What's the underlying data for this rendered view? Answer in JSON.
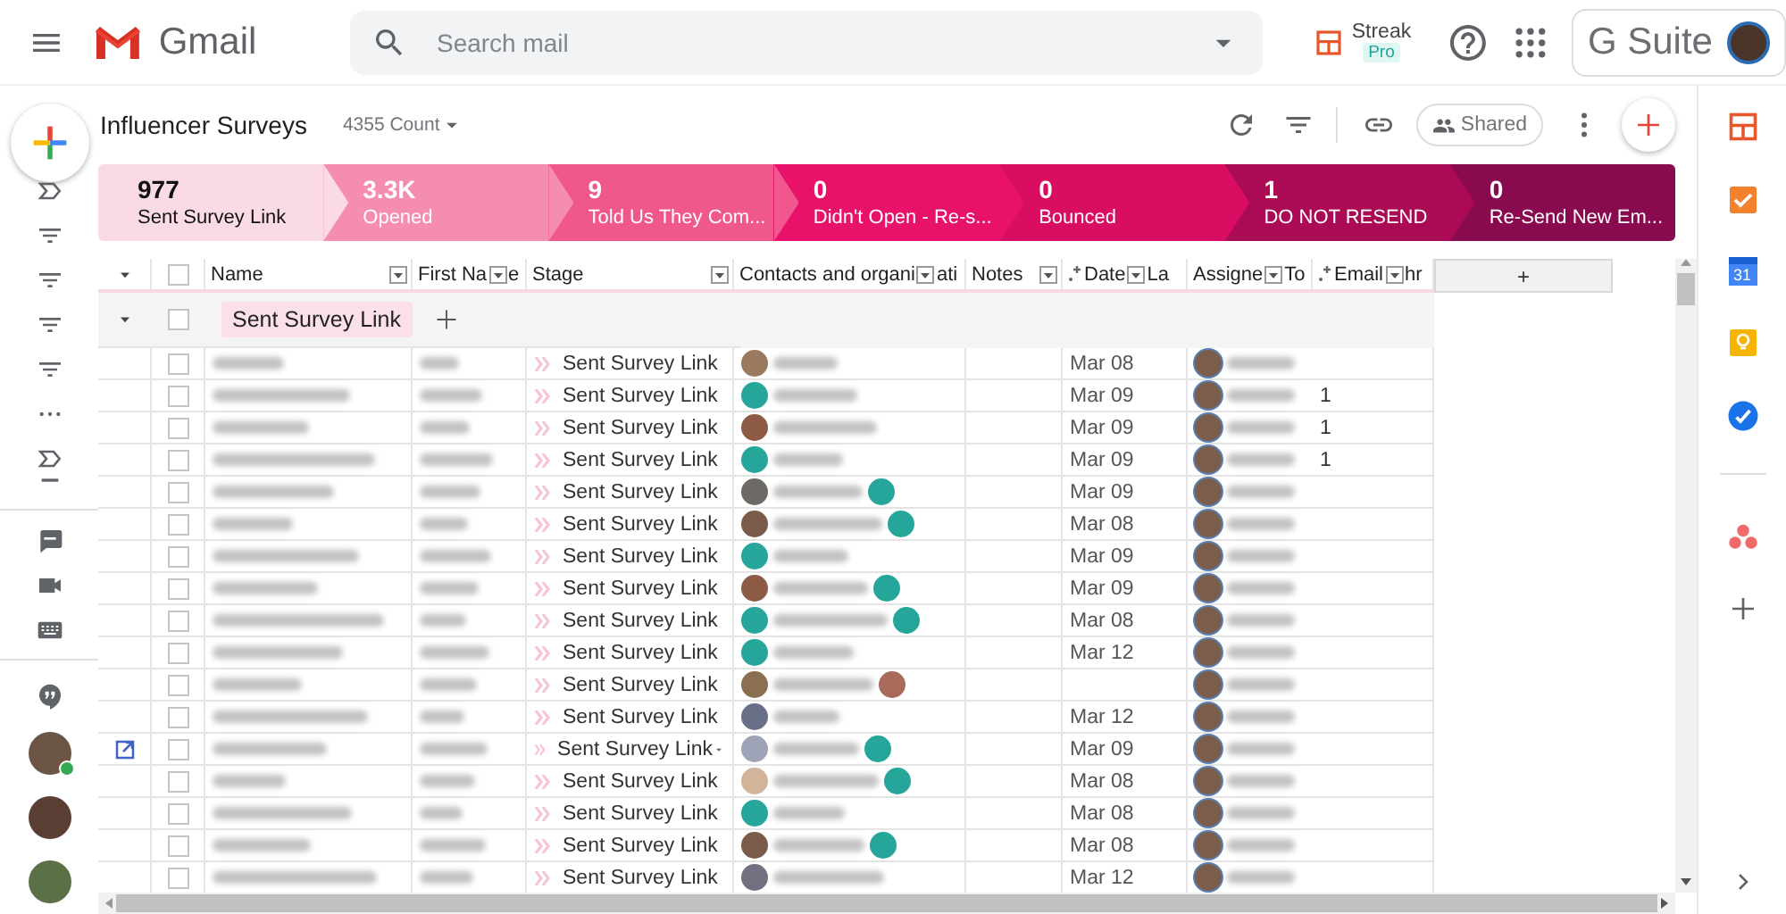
{
  "topbar": {
    "app_name": "Gmail",
    "search": {
      "placeholder": "Search mail"
    },
    "streak": {
      "label": "Streak",
      "badge": "Pro"
    },
    "suite": {
      "label": "G Suite"
    }
  },
  "rail": {
    "contacts": [
      {
        "online": true
      },
      {
        "online": false
      },
      {
        "online": false
      }
    ]
  },
  "pipeline": {
    "title": "Influencer Surveys",
    "count": "4355 Count",
    "share": {
      "label": "Shared"
    }
  },
  "stages": [
    {
      "count": "977",
      "label": "Sent Survey Link",
      "color": "#fadbe5"
    },
    {
      "count": "3.3K",
      "label": "Opened",
      "color": "#f58db0"
    },
    {
      "count": "9",
      "label": "Told Us They Com...",
      "color": "#f0588d"
    },
    {
      "count": "0",
      "label": "Didn't Open - Re-s...",
      "color": "#e8126a"
    },
    {
      "count": "0",
      "label": "Bounced",
      "color": "#d90d62"
    },
    {
      "count": "1",
      "label": "DO NOT RESEND",
      "color": "#ab0a54"
    },
    {
      "count": "0",
      "label": "Re-Send New Em...",
      "color": "#8a0a4f"
    }
  ],
  "table": {
    "columns": [
      {
        "label": "Name",
        "kind": "field"
      },
      {
        "label": "First Na",
        "tail": "e",
        "kind": "field"
      },
      {
        "label": "Stage",
        "kind": "field"
      },
      {
        "label": "Contacts and organi",
        "tail": "ati",
        "kind": "field"
      },
      {
        "label": "Notes",
        "kind": "field"
      },
      {
        "label": "Date",
        "tail": "La",
        "kind": "auto"
      },
      {
        "label": "Assigne",
        "tail": "To",
        "kind": "field"
      },
      {
        "label": "Email",
        "tail": "hr",
        "kind": "auto"
      }
    ],
    "all_checked": false,
    "add_column": "+",
    "group": {
      "label": "Sent Survey Link",
      "expanded": true,
      "checked": false
    },
    "rows": [
      {
        "stage": "Sent Survey Link",
        "date": "Mar 08",
        "checked": false,
        "hovered": false,
        "contacts": [
          {
            "color": "#9a7a5e"
          }
        ]
      },
      {
        "stage": "Sent Survey Link",
        "date": "Mar 09",
        "email": "1",
        "checked": false,
        "hovered": false,
        "contacts": [
          {
            "color": "#26a69a"
          }
        ]
      },
      {
        "stage": "Sent Survey Link",
        "date": "Mar 09",
        "email": "1",
        "checked": false,
        "hovered": false,
        "contacts": [
          {
            "color": "#8d5a44"
          }
        ]
      },
      {
        "stage": "Sent Survey Link",
        "date": "Mar 09",
        "email": "1",
        "checked": false,
        "hovered": false,
        "contacts": [
          {
            "color": "#26a69a"
          }
        ]
      },
      {
        "stage": "Sent Survey Link",
        "date": "Mar 09",
        "checked": false,
        "hovered": false,
        "contacts": [
          {
            "color": "#6d6a66"
          },
          {
            "color": "#26a69a"
          }
        ]
      },
      {
        "stage": "Sent Survey Link",
        "date": "Mar 08",
        "checked": false,
        "hovered": false,
        "contacts": [
          {
            "color": "#7a5a48"
          },
          {
            "color": "#26a69a"
          }
        ]
      },
      {
        "stage": "Sent Survey Link",
        "date": "Mar 09",
        "checked": false,
        "hovered": false,
        "contacts": [
          {
            "color": "#26a69a"
          }
        ]
      },
      {
        "stage": "Sent Survey Link",
        "date": "Mar 09",
        "checked": false,
        "hovered": false,
        "contacts": [
          {
            "color": "#8d5a44"
          },
          {
            "color": "#26a69a"
          }
        ]
      },
      {
        "stage": "Sent Survey Link",
        "date": "Mar 08",
        "checked": false,
        "hovered": false,
        "contacts": [
          {
            "color": "#26a69a"
          },
          {
            "color": "#26a69a"
          }
        ]
      },
      {
        "stage": "Sent Survey Link",
        "date": "Mar 12",
        "checked": false,
        "hovered": false,
        "contacts": [
          {
            "color": "#26a69a"
          }
        ]
      },
      {
        "stage": "Sent Survey Link",
        "checked": false,
        "hovered": false,
        "contacts": [
          {
            "color": "#8a7050"
          },
          {
            "color": "#a86a5a"
          }
        ]
      },
      {
        "stage": "Sent Survey Link",
        "date": "Mar 12",
        "checked": false,
        "hovered": false,
        "contacts": [
          {
            "color": "#6a6f88"
          }
        ]
      },
      {
        "stage": "Sent Survey Link",
        "date": "Mar 09",
        "checked": false,
        "hovered": true,
        "contacts": [
          {
            "color": "#9fa3b8"
          },
          {
            "color": "#26a69a"
          }
        ]
      },
      {
        "stage": "Sent Survey Link",
        "date": "Mar 08",
        "checked": false,
        "hovered": false,
        "contacts": [
          {
            "color": "#d2b49a"
          },
          {
            "color": "#26a69a"
          }
        ]
      },
      {
        "stage": "Sent Survey Link",
        "date": "Mar 08",
        "checked": false,
        "hovered": false,
        "contacts": [
          {
            "color": "#26a69a"
          }
        ]
      },
      {
        "stage": "Sent Survey Link",
        "date": "Mar 08",
        "checked": false,
        "hovered": false,
        "contacts": [
          {
            "color": "#7a5a48"
          },
          {
            "color": "#26a69a"
          }
        ]
      },
      {
        "stage": "Sent Survey Link",
        "date": "Mar 12",
        "checked": false,
        "hovered": false,
        "contacts": [
          {
            "color": "#707080"
          }
        ]
      }
    ]
  },
  "side_panel": {
    "calendar_day": "31"
  }
}
